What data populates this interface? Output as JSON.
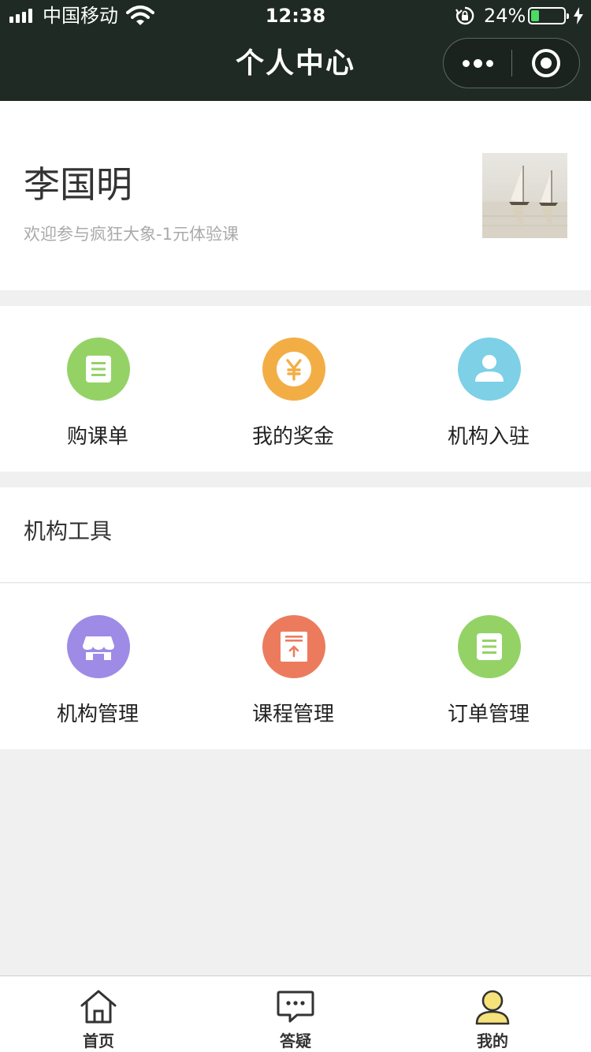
{
  "status_bar": {
    "carrier": "中国移动",
    "time": "12:38",
    "battery_percent_text": "24%",
    "battery_level": 0.24,
    "icons": [
      "signal-icon",
      "wifi-icon",
      "orientation-lock-icon",
      "battery-icon",
      "charging-icon"
    ]
  },
  "nav": {
    "title": "个人中心",
    "icons": [
      "more-icon",
      "close-miniprogram-icon"
    ]
  },
  "profile": {
    "name": "李国明",
    "welcome": "欢迎参与疯狂大象-1元体验课",
    "avatar": "sailboats-photo"
  },
  "quick_actions": [
    {
      "label": "购课单",
      "icon": "document-icon",
      "color": "#94d266"
    },
    {
      "label": "我的奖金",
      "icon": "yuan-coin-icon",
      "color": "#f2ae45"
    },
    {
      "label": "机构入驻",
      "icon": "user-icon",
      "color": "#7dd0e6"
    }
  ],
  "tools": {
    "title": "机构工具",
    "items": [
      {
        "label": "机构管理",
        "icon": "storefront-icon",
        "color": "#9e8be5"
      },
      {
        "label": "课程管理",
        "icon": "upload-document-icon",
        "color": "#ec7b5d"
      },
      {
        "label": "订单管理",
        "icon": "document-icon",
        "color": "#94d266"
      }
    ]
  },
  "tabbar": {
    "tabs": [
      {
        "label": "首页",
        "icon": "home-icon"
      },
      {
        "label": "答疑",
        "icon": "chat-bubble-icon"
      },
      {
        "label": "我的",
        "icon": "profile-icon",
        "active_color": "#f6e27a"
      }
    ]
  }
}
